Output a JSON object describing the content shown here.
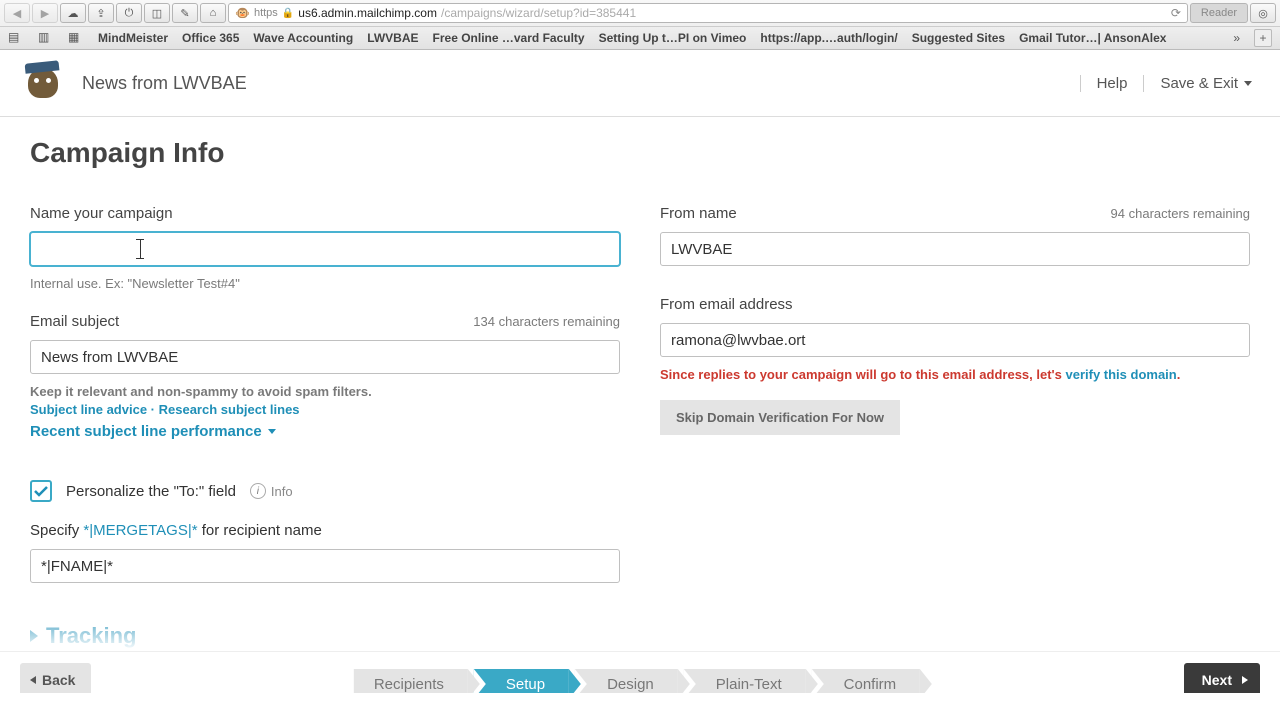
{
  "browser": {
    "protocol": "https",
    "host": "us6.admin.mailchimp.com",
    "path": "/campaigns/wizard/setup?id=385441",
    "reader": "Reader"
  },
  "bookmarks": [
    "MindMeister",
    "Office 365",
    "Wave Accounting",
    "LWVBAE",
    "Free Online …vard Faculty",
    "Setting Up t…PI on Vimeo",
    "https://app.…auth/login/",
    "Suggested Sites",
    "Gmail Tutor…| AnsonAlex"
  ],
  "header": {
    "title": "News from LWVBAE",
    "help": "Help",
    "save_exit": "Save & Exit"
  },
  "page": {
    "heading": "Campaign Info",
    "campaign_name": {
      "label": "Name your campaign",
      "value": "",
      "hint": "Internal use. Ex: \"Newsletter Test#4\""
    },
    "subject": {
      "label": "Email subject",
      "chars": "134 characters remaining",
      "value": "News from LWVBAE",
      "hint": "Keep it relevant and non-spammy to avoid spam filters.",
      "advice": "Subject line advice",
      "research": "Research subject lines",
      "recent": "Recent subject line performance"
    },
    "from_name": {
      "label": "From name",
      "chars": "94 characters remaining",
      "value": "LWVBAE"
    },
    "from_email": {
      "label": "From email address",
      "value": "ramona@lwvbae.ort",
      "warn_pre": "Since replies to your campaign will go to this email address, let's ",
      "warn_link": "verify this domain",
      "warn_post": ".",
      "skip": "Skip Domain Verification For Now"
    },
    "personalize": {
      "label": "Personalize the \"To:\" field",
      "info": "Info",
      "specify_pre": "Specify ",
      "merge": "*|MERGETAGS|*",
      "specify_post": " for recipient name",
      "value": "*|FNAME|*"
    },
    "tracking": "Tracking"
  },
  "wizard": {
    "back": "Back",
    "next": "Next",
    "steps": [
      "Recipients",
      "Setup",
      "Design",
      "Plain-Text",
      "Confirm"
    ],
    "active": 1
  }
}
